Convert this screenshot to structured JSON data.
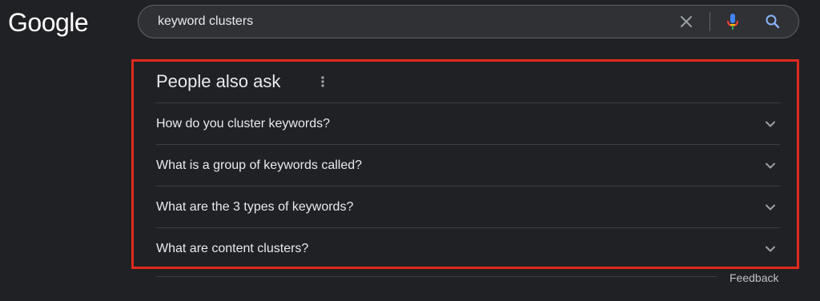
{
  "header": {
    "logo_text": "Google",
    "search": {
      "value": "keyword clusters",
      "clear_icon": "close-icon",
      "mic_icon": "microphone-icon",
      "search_icon": "search-icon"
    }
  },
  "people_also_ask": {
    "title": "People also ask",
    "more_icon": "more-vert-icon",
    "questions": [
      {
        "text": "How do you cluster keywords?",
        "icon": "chevron-down-icon"
      },
      {
        "text": "What is a group of keywords called?",
        "icon": "chevron-down-icon"
      },
      {
        "text": "What are the 3 types of keywords?",
        "icon": "chevron-down-icon"
      },
      {
        "text": "What are content clusters?",
        "icon": "chevron-down-icon"
      }
    ],
    "feedback_label": "Feedback"
  },
  "colors": {
    "background": "#202124",
    "searchbar": "#303134",
    "text": "#e8eaed",
    "highlight_border": "#e0291f",
    "divider": "#3c4043"
  }
}
